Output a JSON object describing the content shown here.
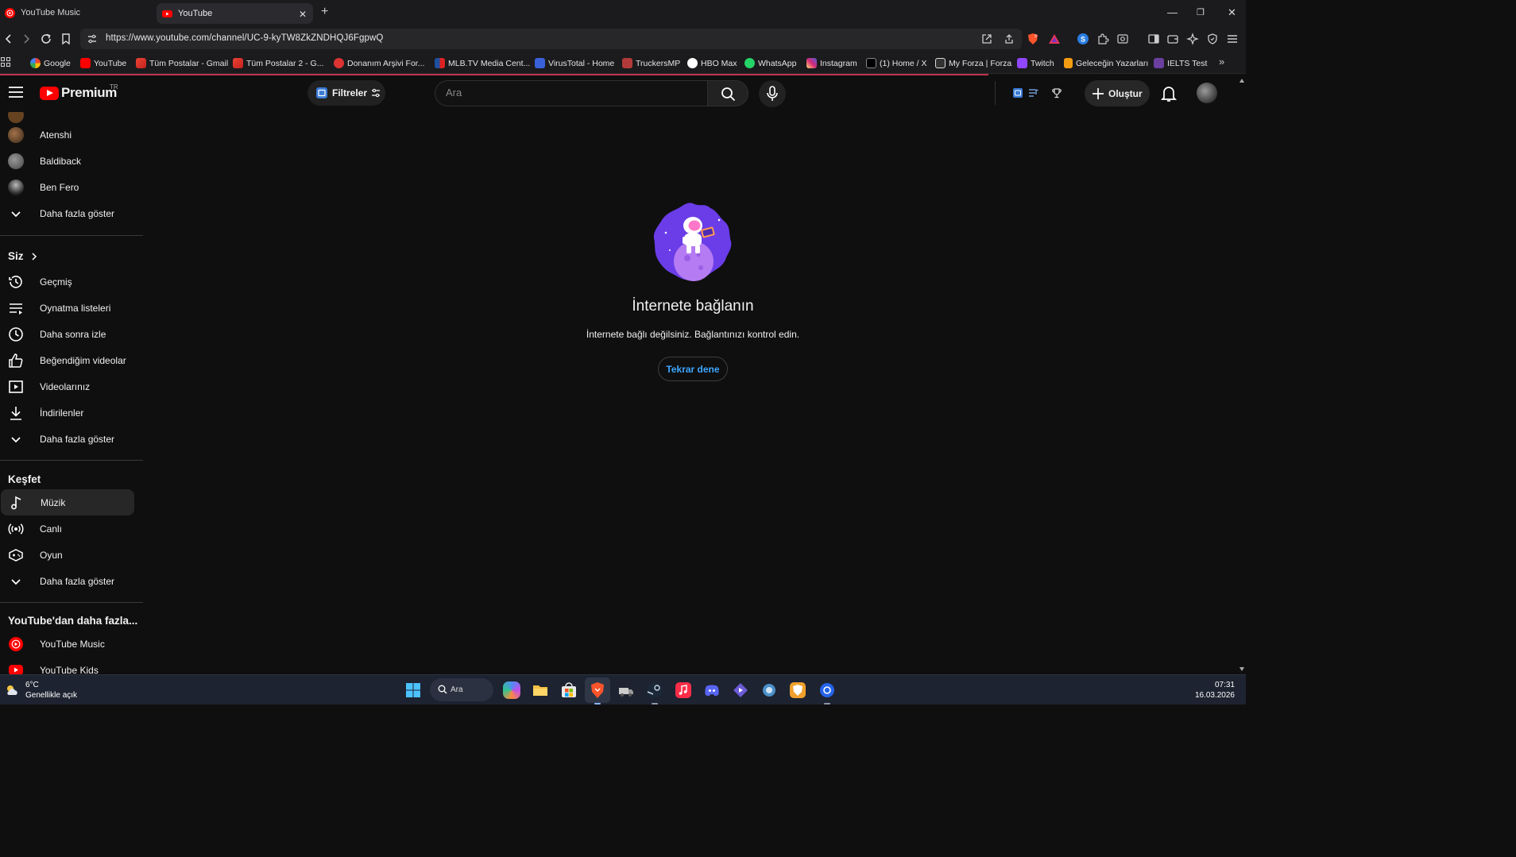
{
  "browser": {
    "tabs": [
      {
        "title": "YouTube Music",
        "active": false
      },
      {
        "title": "YouTube",
        "active": true
      }
    ],
    "url": "https://www.youtube.com/channel/UC-9-kyTW8ZkZNDHQJ6FgpwQ",
    "bookmarks": [
      {
        "label": "Google",
        "color": "#4285f4"
      },
      {
        "label": "YouTube",
        "color": "#ff0000"
      },
      {
        "label": "Tüm Postalar - Gmail",
        "color": "#ea4335"
      },
      {
        "label": "Tüm Postalar 2 - G...",
        "color": "#ea4335"
      },
      {
        "label": "Donanım Arşivi For...",
        "color": "#d33"
      },
      {
        "label": "MLB.TV Media Cent...",
        "color": "#1e4fa0"
      },
      {
        "label": "VirusTotal - Home",
        "color": "#3b61d8"
      },
      {
        "label": "TruckersMP",
        "color": "#b23a3a"
      },
      {
        "label": "HBO Max",
        "color": "#ffffff"
      },
      {
        "label": "WhatsApp",
        "color": "#25d366"
      },
      {
        "label": "Instagram",
        "color": "#d6249f"
      },
      {
        "label": "(1) Home / X",
        "color": "#ffffff"
      },
      {
        "label": "My Forza | Forza",
        "color": "#ffffff"
      },
      {
        "label": "Twitch",
        "color": "#9146ff"
      },
      {
        "label": "Geleceğin Yazarları",
        "color": "#f39c12"
      },
      {
        "label": "IELTS Test",
        "color": "#6b3fa0"
      }
    ]
  },
  "masthead": {
    "logo_text": "Premium",
    "country_code": "TR",
    "filters_label": "Filtreler",
    "search_placeholder": "Ara",
    "create_label": "Oluştur"
  },
  "sidebar": {
    "subscriptions": [
      {
        "label": "Atenshi"
      },
      {
        "label": "Baldiback"
      },
      {
        "label": "Ben Fero"
      }
    ],
    "show_more_1": "Daha fazla göster",
    "you_header": "Siz",
    "you_items": [
      {
        "label": "Geçmiş",
        "icon": "history-icon"
      },
      {
        "label": "Oynatma listeleri",
        "icon": "playlists-icon"
      },
      {
        "label": "Daha sonra izle",
        "icon": "watch-later-icon"
      },
      {
        "label": "Beğendiğim videolar",
        "icon": "like-icon"
      },
      {
        "label": "Videolarınız",
        "icon": "your-videos-icon"
      },
      {
        "label": "İndirilenler",
        "icon": "download-icon"
      }
    ],
    "show_more_2": "Daha fazla göster",
    "explore_header": "Keşfet",
    "explore_items": [
      {
        "label": "Müzik",
        "icon": "music-icon",
        "active": true
      },
      {
        "label": "Canlı",
        "icon": "live-icon"
      },
      {
        "label": "Oyun",
        "icon": "gaming-icon"
      }
    ],
    "show_more_3": "Daha fazla göster",
    "more_header": "YouTube'dan daha fazla...",
    "more_items": [
      {
        "label": "YouTube Music",
        "icon": "youtube-music-icon"
      },
      {
        "label": "YouTube Kids",
        "icon": "youtube-kids-icon"
      }
    ]
  },
  "offline": {
    "title": "İnternete bağlanın",
    "message": "İnternete bağlı değilsiniz. Bağlantınızı kontrol edin.",
    "retry_label": "Tekrar dene"
  },
  "taskbar": {
    "weather_temp": "6°C",
    "weather_desc": "Genellikle açık",
    "search_label": "Ara",
    "time": "07:31",
    "date": "16.03.2026"
  }
}
